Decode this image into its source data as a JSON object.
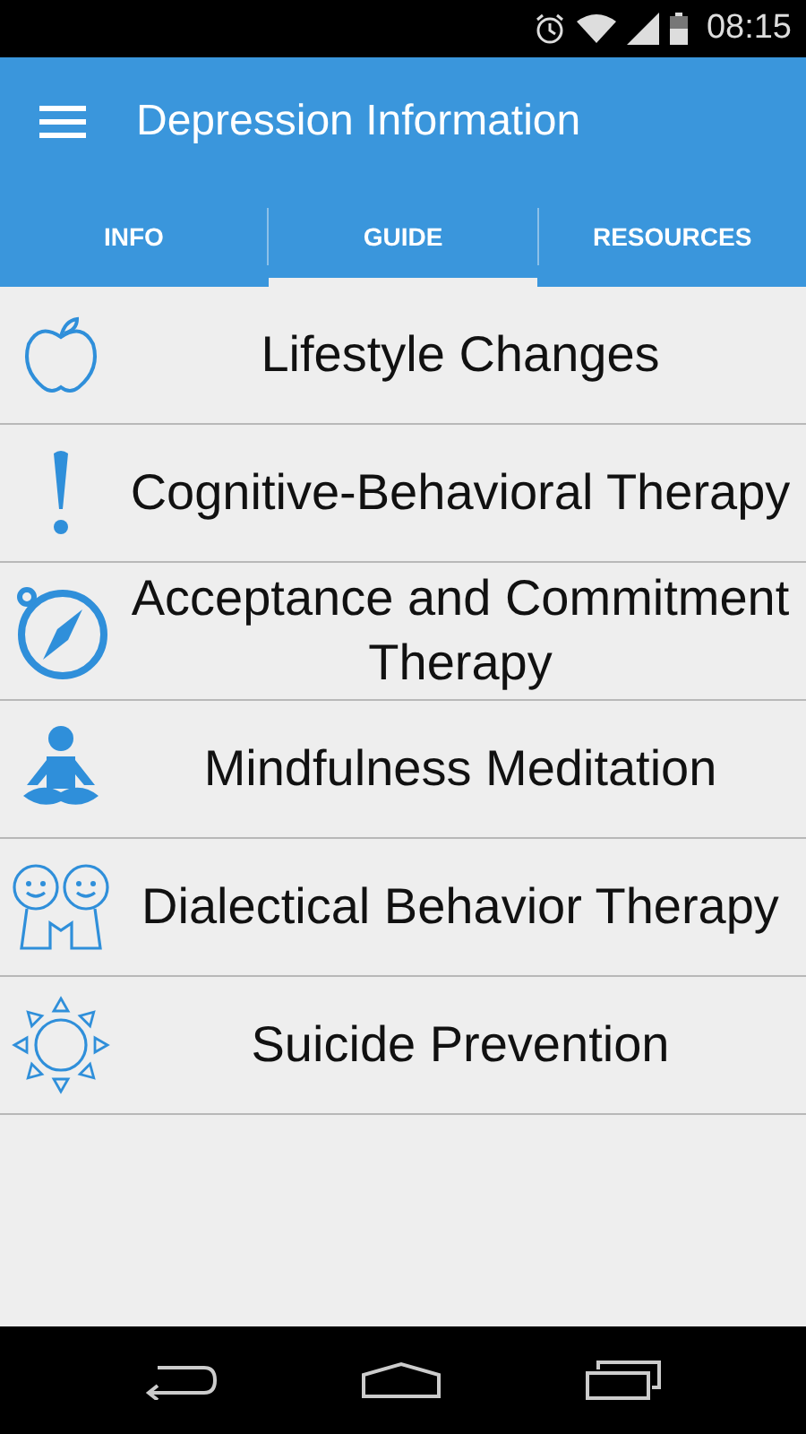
{
  "status_bar": {
    "time": "08:15"
  },
  "app_bar": {
    "title": "Depression Information"
  },
  "tabs": [
    {
      "label": "INFO",
      "selected": false
    },
    {
      "label": "GUIDE",
      "selected": true
    },
    {
      "label": "RESOURCES",
      "selected": false
    }
  ],
  "items": [
    {
      "label": "Lifestyle Changes",
      "kind": "apple"
    },
    {
      "label": "Cognitive-Behavioral Therapy",
      "kind": "exclamation"
    },
    {
      "label": "Acceptance and Commitment Therapy",
      "kind": "compass"
    },
    {
      "label": "Mindfulness Meditation",
      "kind": "meditation"
    },
    {
      "label": "Dialectical Behavior Therapy",
      "kind": "friends"
    },
    {
      "label": "Suicide Prevention",
      "kind": "sun"
    }
  ]
}
